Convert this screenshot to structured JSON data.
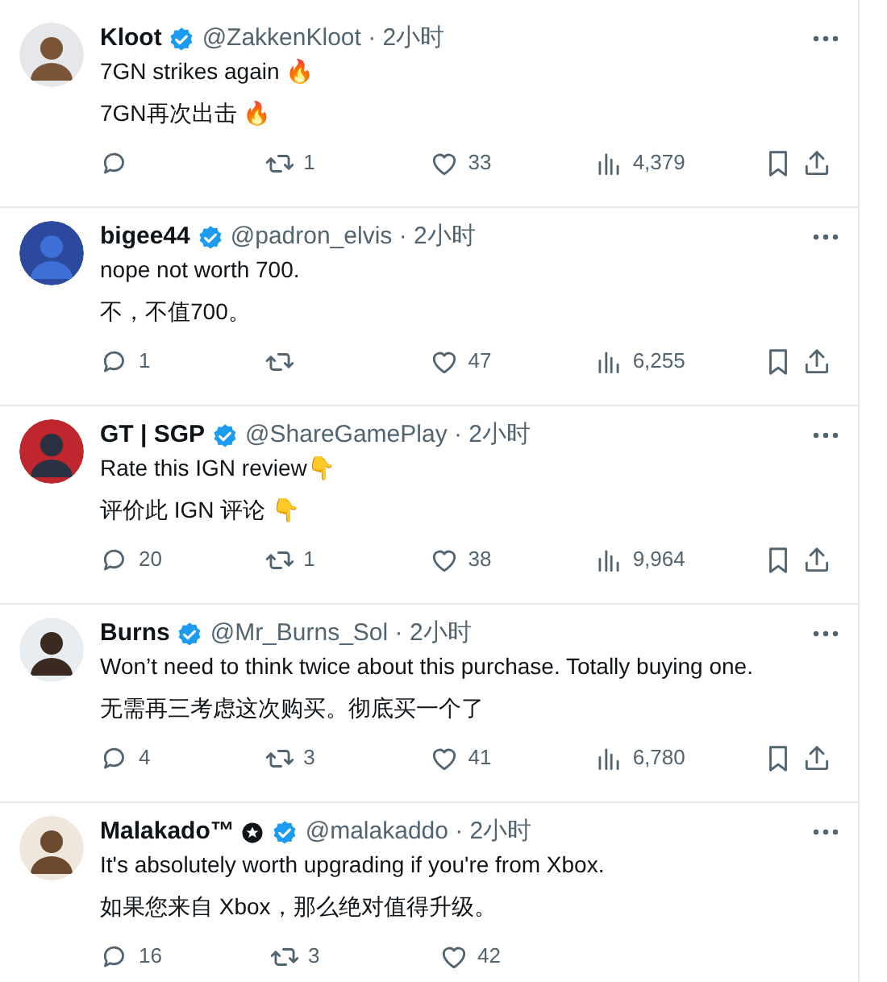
{
  "tweets": [
    {
      "name": "Kloot",
      "verified": true,
      "affiliate_badge": false,
      "meta": "@ZakkenKloot · 2小时",
      "text": "7GN strikes again 🔥",
      "translation": "7GN再次出击 🔥",
      "actions": [
        {
          "kind": "reply"
        },
        {
          "kind": "retweet",
          "count": "1"
        },
        {
          "kind": "like",
          "count": "33"
        },
        {
          "kind": "views",
          "count": "4,379"
        },
        {
          "kind": "bookmark"
        },
        {
          "kind": "share"
        }
      ]
    },
    {
      "name": "bigee44",
      "verified": true,
      "affiliate_badge": false,
      "meta": "@padron_elvis · 2小时",
      "text": "nope not worth 700.",
      "translation": "不，不值700。",
      "actions": [
        {
          "kind": "reply",
          "count": "1"
        },
        {
          "kind": "retweet"
        },
        {
          "kind": "like",
          "count": "47"
        },
        {
          "kind": "views",
          "count": "6,255"
        },
        {
          "kind": "bookmark"
        },
        {
          "kind": "share"
        }
      ]
    },
    {
      "name": "GT | SGP",
      "verified": true,
      "affiliate_badge": false,
      "meta": "@ShareGamePlay · 2小时",
      "text": "Rate this IGN review👇",
      "translation": "评价此 IGN 评论 👇",
      "actions": [
        {
          "kind": "reply",
          "count": "20"
        },
        {
          "kind": "retweet",
          "count": "1"
        },
        {
          "kind": "like",
          "count": "38"
        },
        {
          "kind": "views",
          "count": "9,964"
        },
        {
          "kind": "bookmark"
        },
        {
          "kind": "share"
        }
      ]
    },
    {
      "name": "Burns",
      "verified": true,
      "affiliate_badge": false,
      "meta": "@Mr_Burns_Sol · 2小时",
      "text": "Won’t need to think twice about this purchase. Totally buying one.",
      "translation": "无需再三考虑这次购买。彻底买一个了",
      "actions": [
        {
          "kind": "reply",
          "count": "4"
        },
        {
          "kind": "retweet",
          "count": "3"
        },
        {
          "kind": "like",
          "count": "41"
        },
        {
          "kind": "views",
          "count": "6,780"
        },
        {
          "kind": "bookmark"
        },
        {
          "kind": "share"
        }
      ]
    },
    {
      "name": "Malakado™",
      "verified": true,
      "affiliate_badge": true,
      "meta": "@malakaddo · 2小时",
      "text": "It's absolutely worth upgrading if you're from Xbox.",
      "translation": "如果您来自 Xbox，那么绝对值得升级。",
      "actions": [
        {
          "kind": "reply",
          "count": "16"
        },
        {
          "kind": "retweet",
          "count": "3"
        },
        {
          "kind": "like",
          "count": "42"
        }
      ]
    }
  ]
}
